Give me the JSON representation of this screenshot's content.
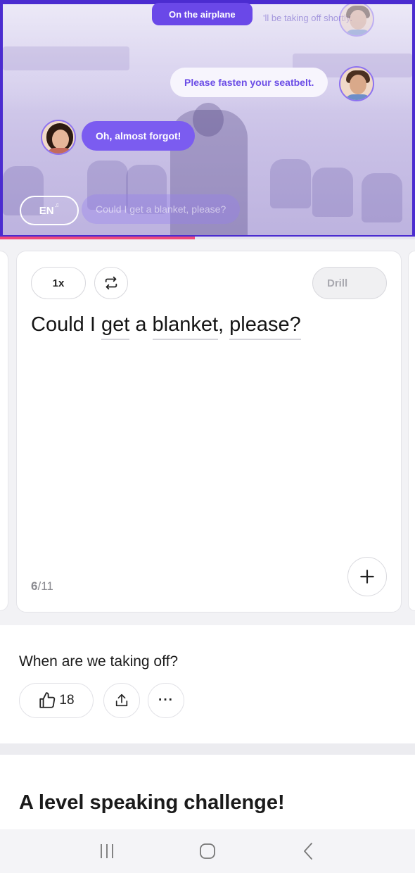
{
  "scene": {
    "title": "On the airplane",
    "faded_line": "'ll be taking off shortly.",
    "lines": [
      {
        "speaker": "man",
        "text": "Please fasten your seatbelt."
      },
      {
        "speaker": "woman",
        "text": "Oh, almost forgot!"
      },
      {
        "speaker": "woman",
        "text": "Could I get a blanket, please?"
      }
    ],
    "language": "EN",
    "progress_fraction": 0.47,
    "colors": {
      "frame": "#4b2cd0",
      "accent": "#7b5cf0",
      "progress": "#ef4a7a"
    }
  },
  "card": {
    "speed_label": "1x",
    "repeat_icon": "repeat-icon",
    "drill_label": "Drill",
    "drill_enabled": false,
    "sentence_parts": [
      "Could I ",
      "get",
      " a ",
      "blanket",
      ", ",
      "please?"
    ],
    "counter_current": "6",
    "counter_total": "/11",
    "add_icon": "plus-icon"
  },
  "question": {
    "text": "When are we taking off?",
    "like_count": "18",
    "like_icon": "thumbs-up-icon",
    "share_icon": "share-icon",
    "more_label": "···"
  },
  "challenge": {
    "title": "A level speaking challenge!"
  },
  "navbar": {
    "recents_icon": "recents-icon",
    "home_icon": "home-icon",
    "back_icon": "back-icon"
  }
}
